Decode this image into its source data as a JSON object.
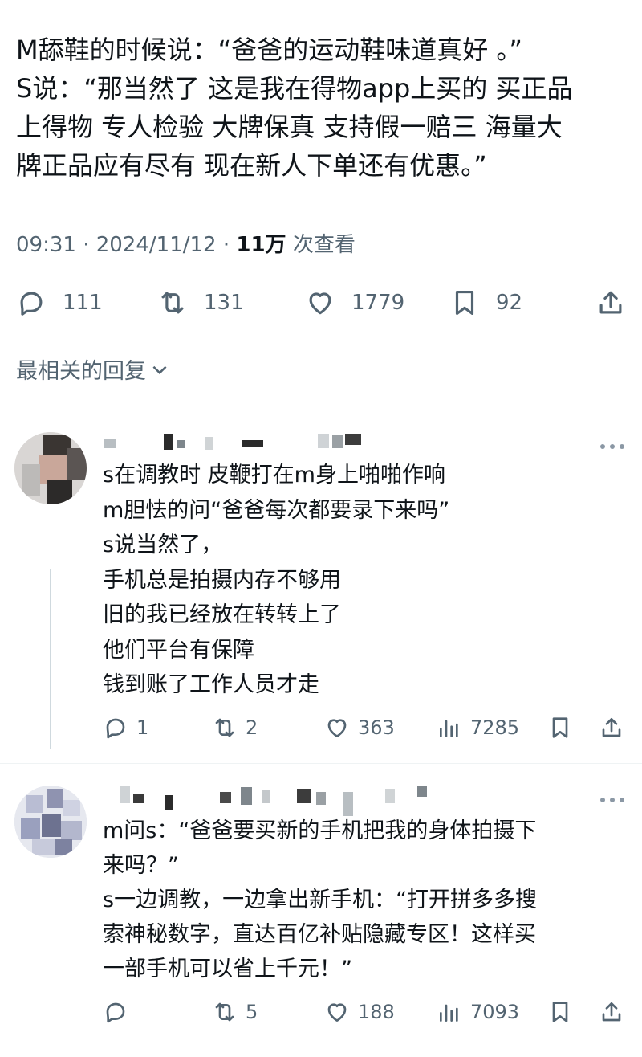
{
  "post": {
    "lines": [
      "M舔鞋的时候说：“爸爸的运动鞋味道真好 。”",
      "S说：“那当然了 这是我在得物app上买的 买正品",
      "上得物 专人检验 大牌保真 支持假一赔三 海量大",
      "牌正品应有尽有 现在新人下单还有优惠。”"
    ],
    "time": "09:31 · 2024/11/12 · ",
    "views_count": "11万",
    "views_label": " 次查看",
    "actions": {
      "replies": "111",
      "reposts": "131",
      "likes": "1779",
      "bookmarks": "92"
    }
  },
  "replies_sort_label": "最相关的回复",
  "replies": [
    {
      "lines": [
        "s在调教时 皮鞭打在m身上啪啪作响",
        "m胆怯的问“爸爸每次都要录下来吗”",
        "s说当然了，",
        "手机总是拍摄内存不够用",
        "旧的我已经放在转转上了",
        "他们平台有保障",
        "钱到账了工作人员才走"
      ],
      "actions": {
        "replies": "1",
        "reposts": "2",
        "likes": "363",
        "views": "7285"
      }
    },
    {
      "lines": [
        "m问s：“爸爸要买新的手机把我的身体拍摄下",
        "来吗？”",
        "s一边调教，一边拿出新手机：“打开拼多多搜",
        "索神秘数字，直达百亿补贴隐藏专区！这样买",
        "一部手机可以省上千元！”"
      ],
      "actions": {
        "replies": "",
        "reposts": "5",
        "likes": "188",
        "views": "7093"
      }
    }
  ],
  "icons": {
    "reply": "speech-bubble-icon",
    "repost": "repost-arrows-icon",
    "like": "heart-icon",
    "bookmark": "bookmark-icon",
    "share": "share-upload-icon",
    "views": "bar-chart-icon",
    "more": "more-dots-icon",
    "sort": "chevron-down-icon"
  },
  "colors": {
    "text": "#0f1419",
    "secondary": "#536471",
    "divider": "#eff3f4",
    "background": "#ffffff"
  }
}
